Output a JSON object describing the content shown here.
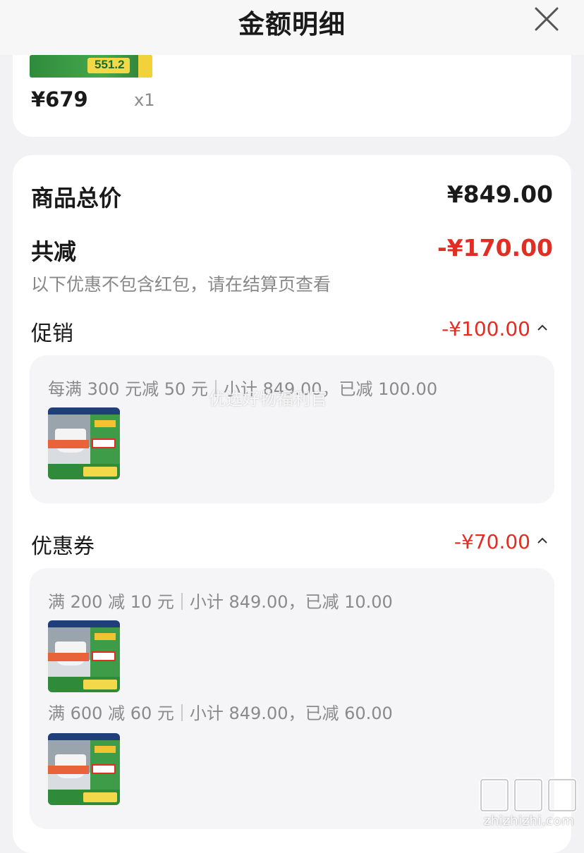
{
  "header": {
    "title": "金额明细",
    "close_icon": "close-icon"
  },
  "product": {
    "price": "¥679",
    "quantity": "x1",
    "banner_text": "551.2"
  },
  "summary": {
    "total_label": "商品总价",
    "total_value": "¥849.00",
    "discount_label": "共减",
    "discount_value": "-¥170.00",
    "note": "以下优惠不包含红包，请在结算页查看"
  },
  "sections": [
    {
      "label": "促销",
      "value": "-¥100.00",
      "rules": [
        {
          "rule": "每满 300 元减 50 元",
          "detail": "小计 849.00，已减 100.00"
        }
      ]
    },
    {
      "label": "优惠券",
      "value": "-¥70.00",
      "rules": [
        {
          "rule": "满 200 减 10 元",
          "detail": "小计 849.00，已减 10.00"
        },
        {
          "rule": "满 600 减 60 元",
          "detail": "小计 849.00，已减 60.00"
        }
      ]
    }
  ],
  "watermark": "优选好物福利官",
  "site": {
    "logo": "值值值",
    "url": "zhizhizhi.com"
  },
  "colors": {
    "accent_red": "#e02e24",
    "background": "#f2f2f4"
  }
}
